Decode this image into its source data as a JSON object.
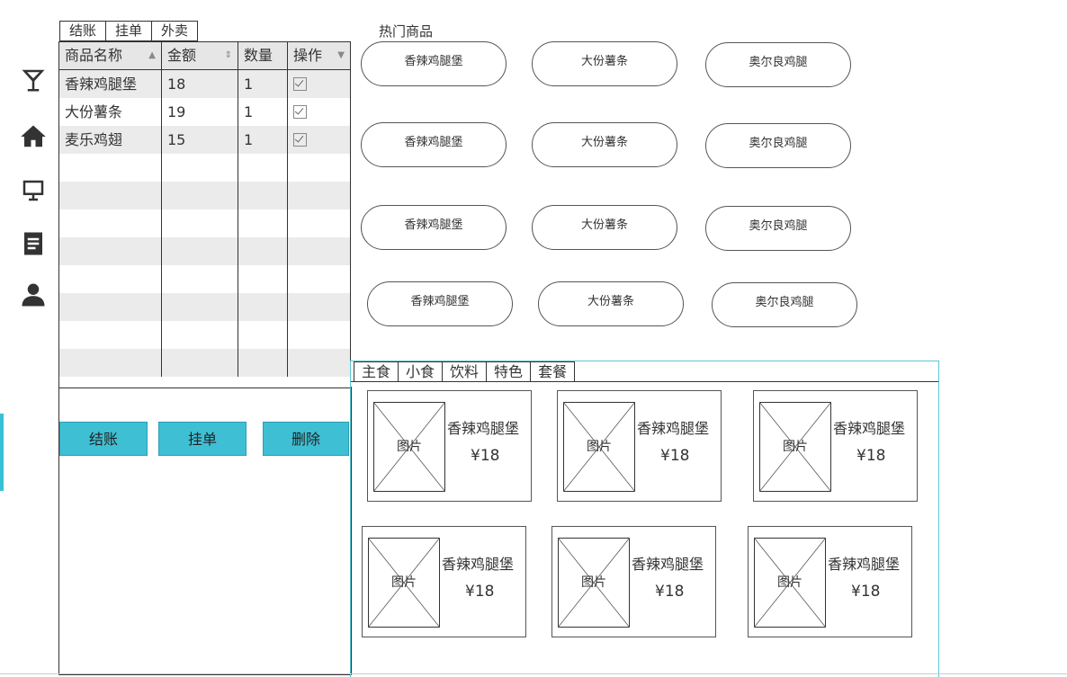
{
  "top_tabs": [
    "结账",
    "挂单",
    "外卖"
  ],
  "table": {
    "headers": [
      "商品名称",
      "金额",
      "数量",
      "操作"
    ],
    "rows": [
      {
        "name": "香辣鸡腿堡",
        "amount": "18",
        "qty": "1"
      },
      {
        "name": "大份薯条",
        "amount": "19",
        "qty": "1"
      },
      {
        "name": "麦乐鸡翅",
        "amount": "15",
        "qty": "1"
      }
    ]
  },
  "actions": {
    "checkout": "结账",
    "hold": "挂单",
    "delete": "删除"
  },
  "hot": {
    "title": "热门商品",
    "items": [
      "香辣鸡腿堡",
      "大份薯条",
      "奥尔良鸡腿",
      "香辣鸡腿堡",
      "大份薯条",
      "奥尔良鸡腿",
      "香辣鸡腿堡",
      "大份薯条",
      "奥尔良鸡腿",
      "香辣鸡腿堡",
      "大份薯条",
      "奥尔良鸡腿"
    ]
  },
  "categories": [
    "主食",
    "小食",
    "饮料",
    "特色",
    "套餐"
  ],
  "products": [
    {
      "image": "图片",
      "name": "香辣鸡腿堡",
      "price": "¥18"
    },
    {
      "image": "图片",
      "name": "香辣鸡腿堡",
      "price": "¥18"
    },
    {
      "image": "图片",
      "name": "香辣鸡腿堡",
      "price": "¥18"
    },
    {
      "image": "图片",
      "name": "香辣鸡腿堡",
      "price": "¥18"
    },
    {
      "image": "图片",
      "name": "香辣鸡腿堡",
      "price": "¥18"
    },
    {
      "image": "图片",
      "name": "香辣鸡腿堡",
      "price": "¥18"
    }
  ],
  "icons": [
    "cocktail-icon",
    "home-icon",
    "monitor-icon",
    "document-icon",
    "user-icon"
  ],
  "accent_color": "#3fbfd4"
}
